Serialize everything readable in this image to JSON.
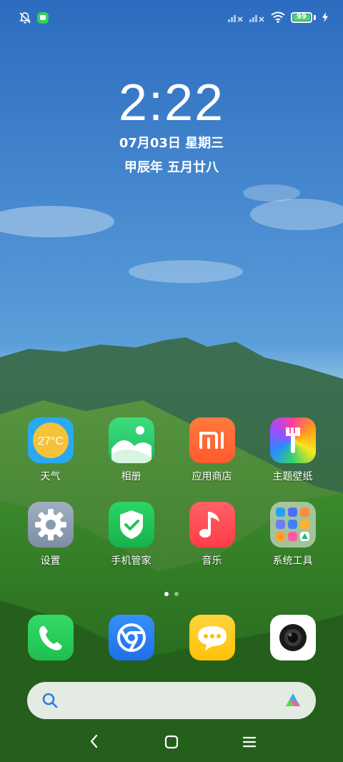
{
  "status_bar": {
    "icons": [
      "bell-muted-icon",
      "notification-app-icon",
      "signal-no-sim-icon",
      "signal-no-sim-icon",
      "wifi-icon",
      "battery-icon",
      "charging-bolt-icon"
    ],
    "battery_level": "99"
  },
  "clock": {
    "time": "2:22",
    "date": "07月03日 星期三",
    "lunar": "甲辰年 五月廿八"
  },
  "apps_row1": [
    {
      "label": "天气",
      "icon": "weather-icon",
      "icon_text": "27°C",
      "color": "#f5b82e"
    },
    {
      "label": "相册",
      "icon": "gallery-icon",
      "color": "#3ddc84"
    },
    {
      "label": "应用商店",
      "icon": "app-store-icon",
      "icon_text": "mi",
      "color": "#ff6b35"
    },
    {
      "label": "主题壁纸",
      "icon": "themes-icon",
      "color": "#ff4fa0"
    }
  ],
  "apps_row2": [
    {
      "label": "设置",
      "icon": "settings-gear-icon",
      "color": "#8a9bb0"
    },
    {
      "label": "手机管家",
      "icon": "security-shield-icon",
      "color": "#21c454"
    },
    {
      "label": "音乐",
      "icon": "music-note-icon",
      "color": "#ff4f56"
    },
    {
      "label": "系统工具",
      "icon": "system-tools-folder-icon",
      "color": "#c9d6c4"
    }
  ],
  "dock": [
    {
      "icon": "phone-icon",
      "color": "#2fd15c"
    },
    {
      "icon": "browser-icon",
      "color": "#2b7cf6"
    },
    {
      "icon": "messages-icon",
      "color": "#ffcd1f"
    },
    {
      "icon": "camera-icon",
      "color": "#ffffff"
    }
  ],
  "search": {
    "icon": "search-icon",
    "assistant_icon": "assistant-icon"
  },
  "nav": {
    "back": "back-icon",
    "home": "home-icon",
    "menu": "menu-icon"
  }
}
